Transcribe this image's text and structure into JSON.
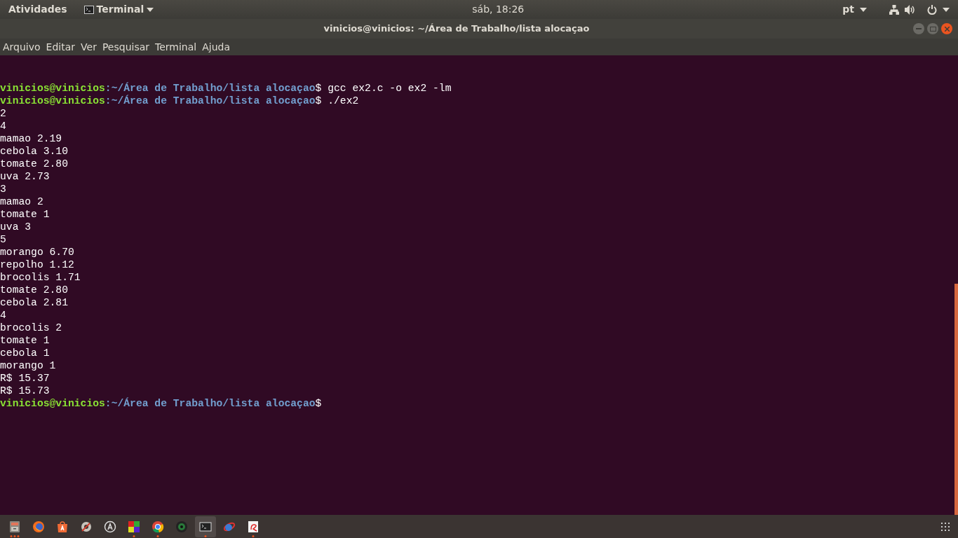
{
  "top_bar": {
    "activities": "Atividades",
    "app_menu": "Terminal",
    "clock": "sáb, 18:26",
    "language": "pt"
  },
  "window": {
    "title": "vinicios@vinicios: ~/Área de Trabalho/lista alocaçao"
  },
  "menu": [
    "Arquivo",
    "Editar",
    "Ver",
    "Pesquisar",
    "Terminal",
    "Ajuda"
  ],
  "terminal_lines": [
    {
      "kind": "blank"
    },
    {
      "kind": "blank"
    },
    {
      "kind": "prompt",
      "user_host": "vinicios@vinicios",
      "path": ":~/Área de Trabalho/lista alocaçao",
      "symbol": "$",
      "command": "gcc ex2.c -o ex2 -lm"
    },
    {
      "kind": "prompt",
      "user_host": "vinicios@vinicios",
      "path": ":~/Área de Trabalho/lista alocaçao",
      "symbol": "$",
      "command": "./ex2"
    },
    {
      "kind": "output",
      "text": "2"
    },
    {
      "kind": "output",
      "text": "4"
    },
    {
      "kind": "output",
      "text": "mamao 2.19"
    },
    {
      "kind": "output",
      "text": "cebola 3.10"
    },
    {
      "kind": "output",
      "text": "tomate 2.80"
    },
    {
      "kind": "output",
      "text": "uva 2.73"
    },
    {
      "kind": "output",
      "text": "3"
    },
    {
      "kind": "output",
      "text": "mamao 2"
    },
    {
      "kind": "output",
      "text": "tomate 1"
    },
    {
      "kind": "output",
      "text": "uva 3"
    },
    {
      "kind": "output",
      "text": "5"
    },
    {
      "kind": "output",
      "text": "morango 6.70"
    },
    {
      "kind": "output",
      "text": "repolho 1.12"
    },
    {
      "kind": "output",
      "text": "brocolis 1.71"
    },
    {
      "kind": "output",
      "text": "tomate 2.80"
    },
    {
      "kind": "output",
      "text": "cebola 2.81"
    },
    {
      "kind": "output",
      "text": "4"
    },
    {
      "kind": "output",
      "text": "brocolis 2"
    },
    {
      "kind": "output",
      "text": "tomate 1"
    },
    {
      "kind": "output",
      "text": "cebola 1"
    },
    {
      "kind": "output",
      "text": "morango 1"
    },
    {
      "kind": "output",
      "text": "R$ 15.37"
    },
    {
      "kind": "output",
      "text": "R$ 15.73"
    },
    {
      "kind": "prompt",
      "user_host": "vinicios@vinicios",
      "path": ":~/Área de Trabalho/lista alocaçao",
      "symbol": "$"
    }
  ],
  "taskbar": [
    {
      "kind": "files",
      "running": true,
      "multi_window": true,
      "selected": false
    },
    {
      "kind": "browser-fox",
      "running": false,
      "selected": false
    },
    {
      "kind": "store",
      "running": false,
      "selected": false
    },
    {
      "kind": "tools",
      "running": false,
      "selected": false
    },
    {
      "kind": "circle-a",
      "running": false,
      "selected": false
    },
    {
      "kind": "squares",
      "running": true,
      "multi_window": false,
      "selected": false
    },
    {
      "kind": "browser-ring",
      "running": true,
      "multi_window": false,
      "selected": false
    },
    {
      "kind": "camera",
      "running": false,
      "selected": false
    },
    {
      "kind": "terminal",
      "running": true,
      "multi_window": false,
      "selected": true
    },
    {
      "kind": "network-globe",
      "running": false,
      "selected": false
    },
    {
      "kind": "document",
      "running": true,
      "multi_window": false,
      "selected": false
    }
  ]
}
